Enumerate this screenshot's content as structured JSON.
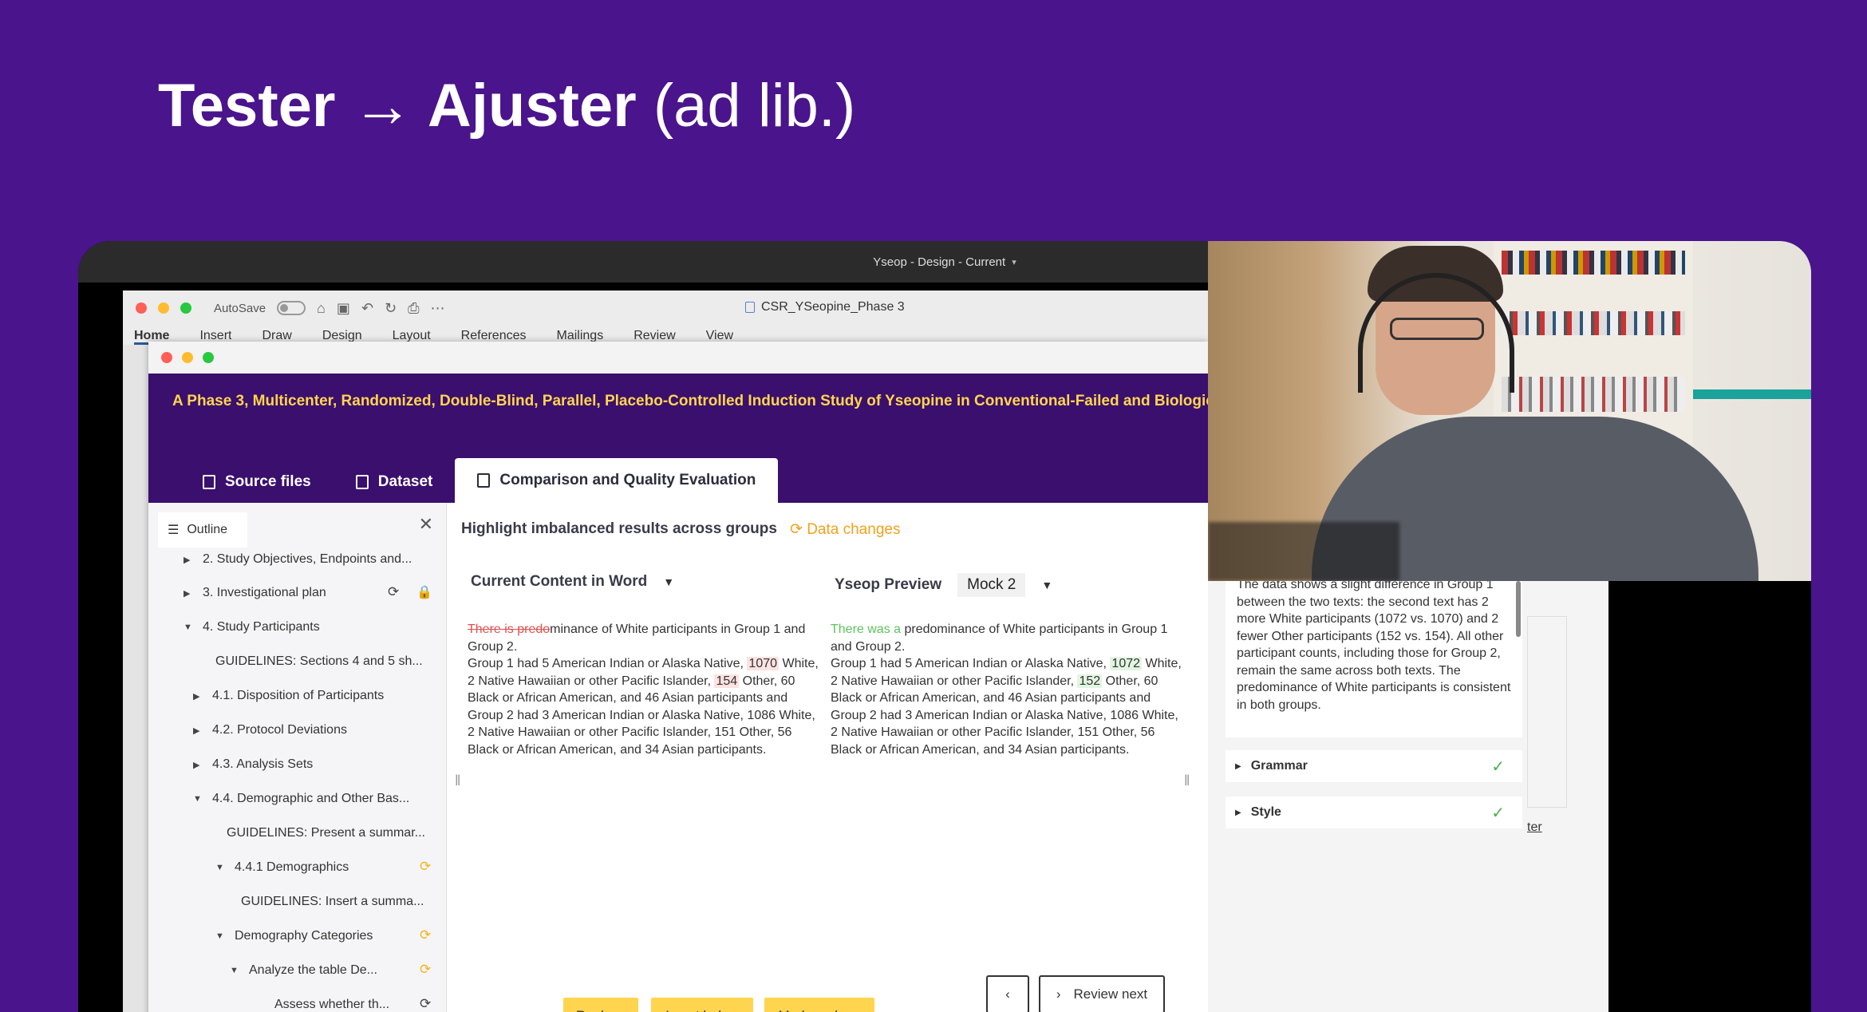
{
  "slide": {
    "title_bold": "Tester → Ajuster",
    "title_light": "(ad lib.)"
  },
  "device_bar": {
    "title": "Yseop - Design - Current"
  },
  "word": {
    "autosave_label": "AutoSave",
    "doc_name": "CSR_YSeopine_Phase 3",
    "ribbon_tabs": [
      "Home",
      "Insert",
      "Draw",
      "Design",
      "Layout",
      "References",
      "Mailings",
      "Review",
      "View"
    ]
  },
  "addin": {
    "study_title": "A Phase 3, Multicenter, Randomized, Double-Blind, Parallel, Placebo-Controlled Induction Study of Yseopine in Conventional-Failed and Biologic",
    "tabs": [
      "Source files",
      "Dataset",
      "Comparison and Quality Evaluation"
    ],
    "outline": {
      "tab_label": "Outline",
      "items": [
        "2. Study Objectives, Endpoints and...",
        "3. Investigational plan",
        "4. Study Participants",
        "GUIDELINES: Sections 4 and 5 sh...",
        "4.1.  Disposition of  Participants",
        "4.2.  Protocol Deviations",
        "4.3.  Analysis Sets",
        "4.4.  Demographic and Other Bas...",
        "GUIDELINES: Present a summar...",
        "4.4.1 Demographics",
        "GUIDELINES: Insert a summa...",
        "Demography Categories",
        "Analyze the table De...",
        "Assess whether th..."
      ]
    },
    "main": {
      "highlight_label": "Highlight imbalanced results across groups",
      "data_changes": "Data changes",
      "left_col_title": "Current Content in Word",
      "right_col_title": "Yseop Preview",
      "mock_select": "Mock 2",
      "left_text": {
        "deleted": "There is predo",
        "rest1": "minance of White participants in Group 1 and Group 2.",
        "rest2": "Group 1 had 5 American Indian or Alaska Native, ",
        "num1": "1070",
        "rest3": " White, 2 Native Hawaiian or other Pacific Islander, ",
        "num2": "154",
        "rest4": " Other, 60 Black or African American, and 46 Asian participants and Group 2 had 3 American Indian or Alaska Native, 1086 White, 2 Native Hawaiian or other Pacific Islander, 151 Other, 56 Black or African American, and 34 Asian participants."
      },
      "right_text": {
        "inserted": "There was a ",
        "rest1": "predominance of White participants in Group 1 and Group 2.",
        "rest2": "Group 1 had 5 American Indian or Alaska Native, ",
        "num1": "1072",
        "rest3": " White, 2 Native Hawaiian or other Pacific Islander, ",
        "num2": "152",
        "rest4": " Other, 60 Black or African American, and 46 Asian participants and Group 2 had 3 American Indian or Alaska Native, 1086 White, 2 Native Hawaiian or other Pacific Islander, 151 Other, 56 Black or African American, and 34 Asian participants."
      },
      "buttons": {
        "replace": "Replace",
        "insert_below": "Insert below",
        "mark_done": "Mark as done",
        "prev": "‹",
        "review_next": "Review next"
      }
    },
    "analysis": {
      "summary": "The data shows a slight difference in Group 1 between the two texts: the second text has 2 more White participants (1072 vs. 1070) and 2 fewer Other participants (152 vs. 154). All other participant counts, including those for Group 2, remain the same across both texts. The predominance of White participants is consistent in both groups.",
      "checks": [
        "Grammar",
        "Style"
      ],
      "side_fragment": "ter"
    }
  }
}
